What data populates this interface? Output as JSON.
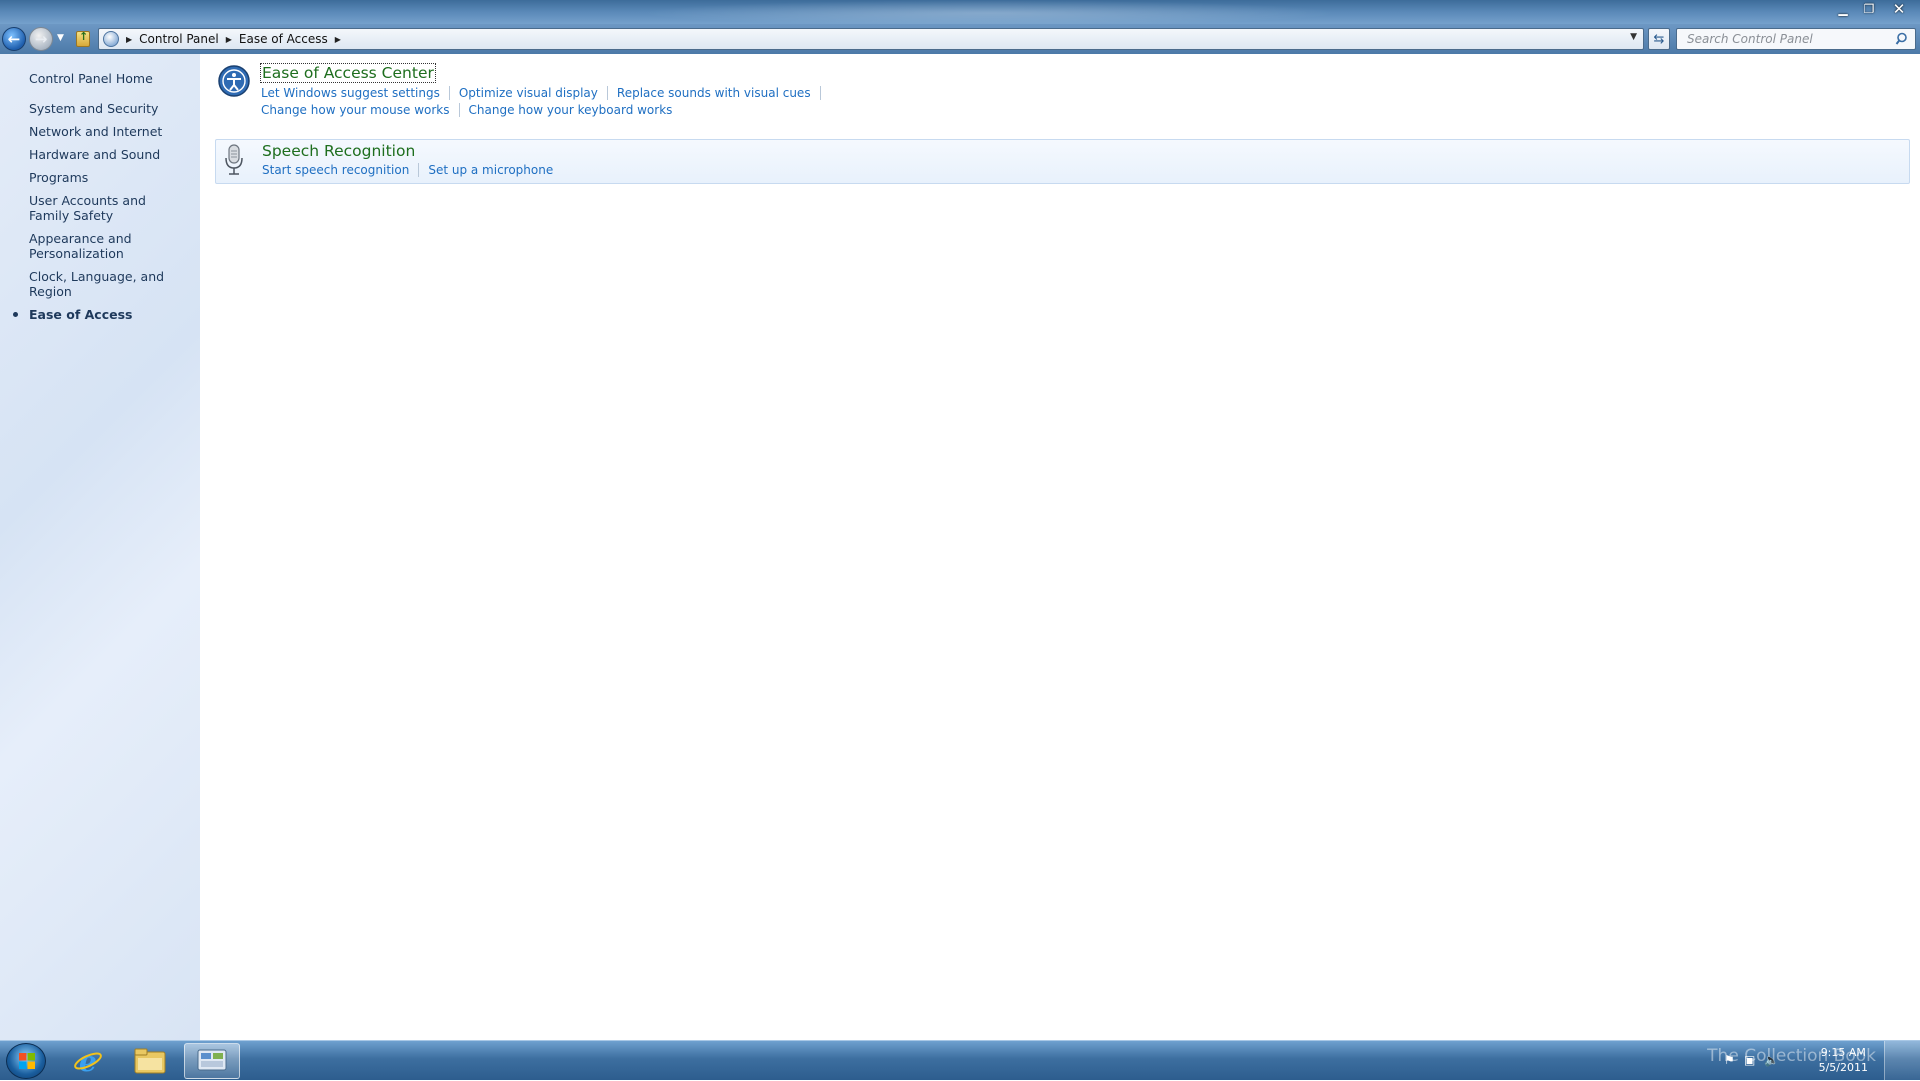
{
  "window": {
    "minimize_glyph": "▁",
    "maximize_glyph": "❐",
    "close_glyph": "✕"
  },
  "address_bar": {
    "crumbs": [
      "Control Panel",
      "Ease of Access"
    ],
    "search_placeholder": "Search Control Panel"
  },
  "sidebar": {
    "home": "Control Panel Home",
    "items": [
      {
        "label": "System and Security"
      },
      {
        "label": "Network and Internet"
      },
      {
        "label": "Hardware and Sound"
      },
      {
        "label": "Programs"
      },
      {
        "label": "User Accounts and Family Safety"
      },
      {
        "label": "Appearance and Personalization"
      },
      {
        "label": "Clock, Language, and Region"
      },
      {
        "label": "Ease of Access"
      }
    ]
  },
  "categories": [
    {
      "title": "Ease of Access Center",
      "icon": "ease-of-access-icon",
      "tasks_row1": [
        "Let Windows suggest settings",
        "Optimize visual display",
        "Replace sounds with visual cues"
      ],
      "tasks_row2": [
        "Change how your mouse works",
        "Change how your keyboard works"
      ]
    },
    {
      "title": "Speech Recognition",
      "icon": "microphone-icon",
      "tasks_row1": [
        "Start speech recognition",
        "Set up a microphone"
      ]
    }
  ],
  "taskbar": {
    "clock_time": "9:15 AM",
    "clock_date": "5/5/2011",
    "watermark": "The Collection Book"
  }
}
